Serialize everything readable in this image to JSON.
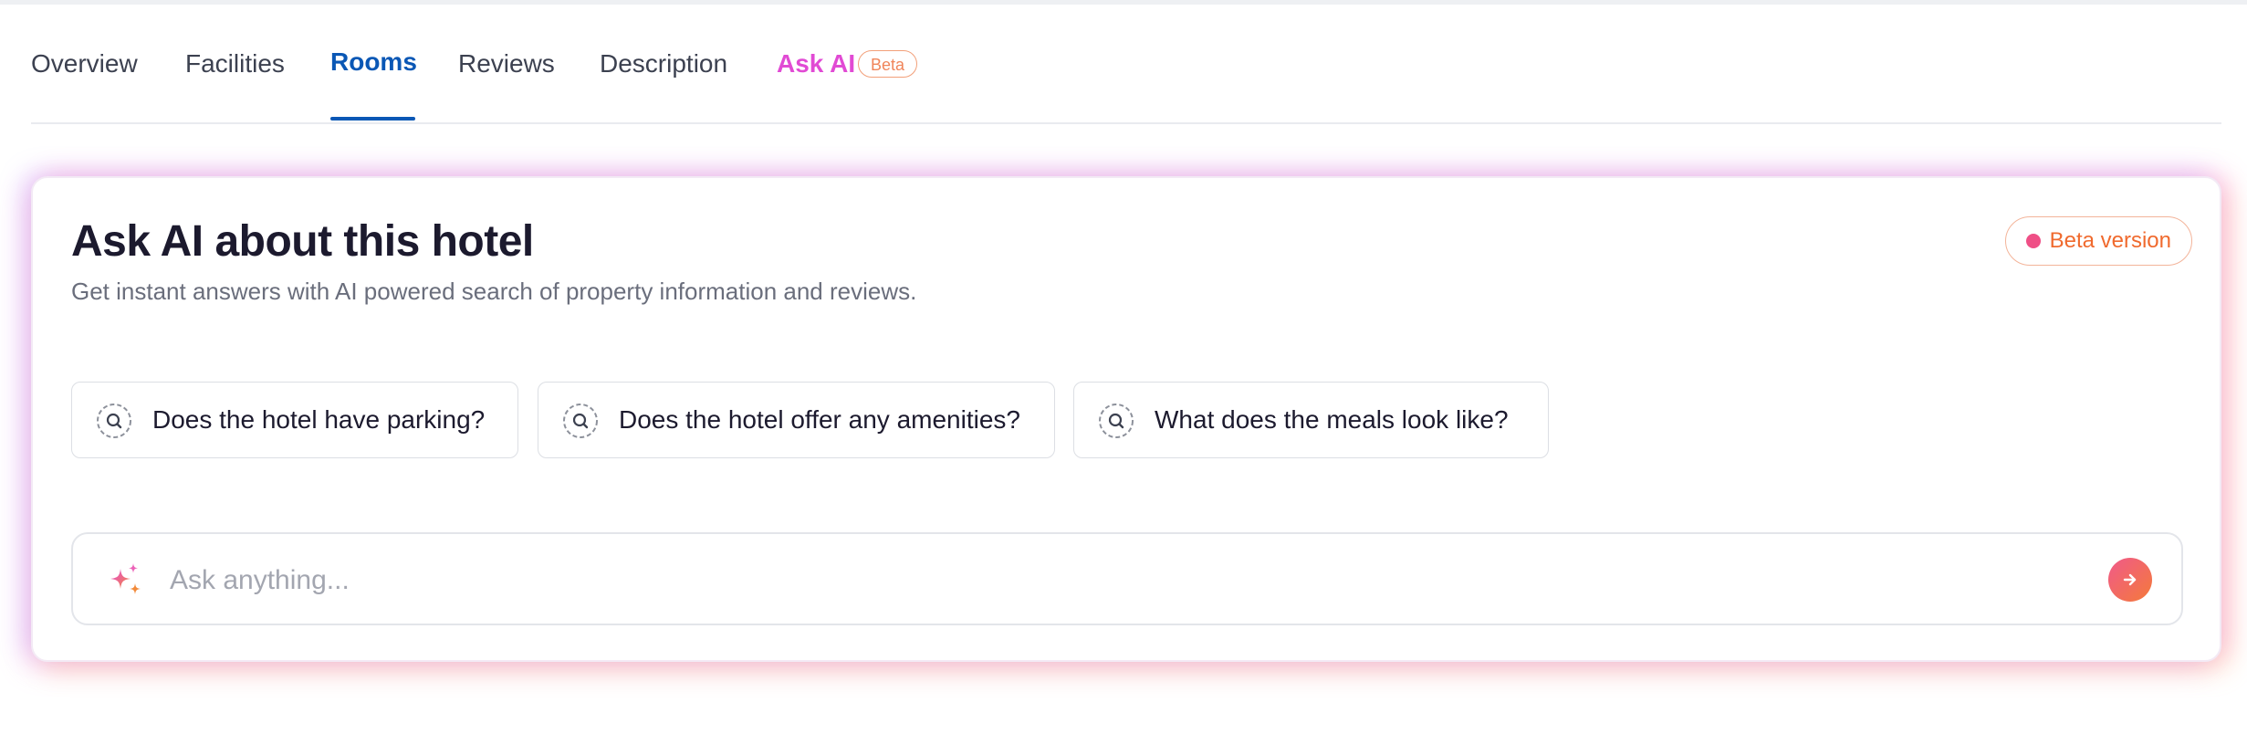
{
  "tabs": [
    {
      "label": "Overview"
    },
    {
      "label": "Facilities"
    },
    {
      "label": "Rooms",
      "active": true
    },
    {
      "label": "Reviews"
    },
    {
      "label": "Description"
    },
    {
      "label": "Ask AI",
      "badge": "Beta"
    }
  ],
  "card": {
    "title": "Ask AI about this hotel",
    "subtitle": "Get instant answers with AI powered search of property information and reviews.",
    "beta_label": "Beta version"
  },
  "suggestions": [
    {
      "label": "Does the hotel have parking?",
      "icon": "search-icon"
    },
    {
      "label": "Does the hotel offer any amenities?",
      "icon": "search-icon"
    },
    {
      "label": "What does the meals look like?",
      "icon": "search-icon"
    }
  ],
  "ask": {
    "placeholder": "Ask anything...",
    "value": "",
    "icon": "sparkle-icon",
    "send_icon": "arrow-right-icon"
  },
  "colors": {
    "active_tab": "#0a57b5",
    "ai_tab": "#e14ad4",
    "beta_accent": "#f06a2e",
    "beta_dot": "#ef4f86",
    "send_gradient_start": "#f05a8a",
    "send_gradient_end": "#f47a3a"
  }
}
